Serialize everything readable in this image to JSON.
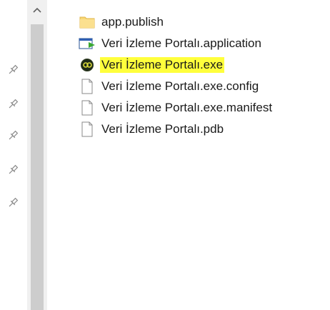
{
  "scrollbar": {
    "up_arrow_icon": "chevron-up-icon"
  },
  "nav_pane": {
    "pins": [
      "pin-icon",
      "pin-icon",
      "pin-icon",
      "pin-icon",
      "pin-icon"
    ]
  },
  "files": [
    {
      "name": "app.publish",
      "icon": "folder-icon",
      "highlighted": false
    },
    {
      "name": "Veri İzleme Portalı.application",
      "icon": "application-manifest-icon",
      "highlighted": false
    },
    {
      "name": "Veri İzleme Portalı.exe",
      "icon": "exe-app-icon",
      "highlighted": true
    },
    {
      "name": "Veri İzleme Portalı.exe.config",
      "icon": "file-icon",
      "highlighted": false
    },
    {
      "name": "Veri İzleme Portalı.exe.manifest",
      "icon": "file-icon",
      "highlighted": false
    },
    {
      "name": "Veri İzleme Portalı.pdb",
      "icon": "file-icon",
      "highlighted": false
    }
  ],
  "colors": {
    "highlight": "#ffff3c",
    "scrollbar_track": "#f0f0f0",
    "scrollbar_thumb": "#cdcdcd",
    "folder": "#f8d775"
  }
}
